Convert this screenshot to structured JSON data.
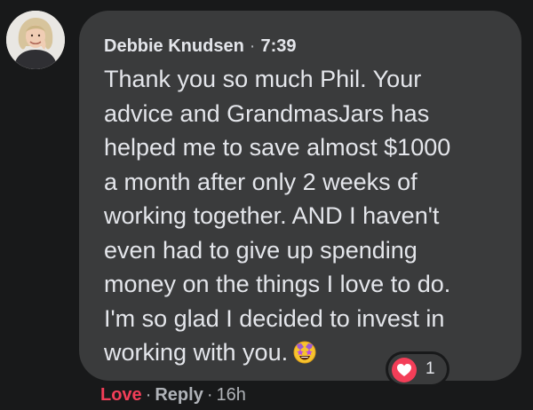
{
  "comment": {
    "author": "Debbie Knudsen",
    "separator": "·",
    "time": "7:39",
    "text": "Thank you so much Phil. Your\nadvice and GrandmasJars has\nhelped me to save almost $1000\na month after only 2 weeks of\nworking together. AND I haven't\neven had to give up spending\nmoney on the things I love to do.\nI'm so glad I decided to invest in\nworking with you.",
    "emoji": "star-struck-emoji"
  },
  "reactions": {
    "icon": "heart-icon",
    "count": "1"
  },
  "actions": {
    "love_label": "Love",
    "reply_label": "Reply",
    "separator": "·",
    "age": "16h"
  },
  "colors": {
    "page_background": "#18191a",
    "bubble_background": "#3a3b3c",
    "text_primary": "#e4e6eb",
    "text_secondary": "#b0b3b8",
    "love_red": "#f33e58"
  }
}
